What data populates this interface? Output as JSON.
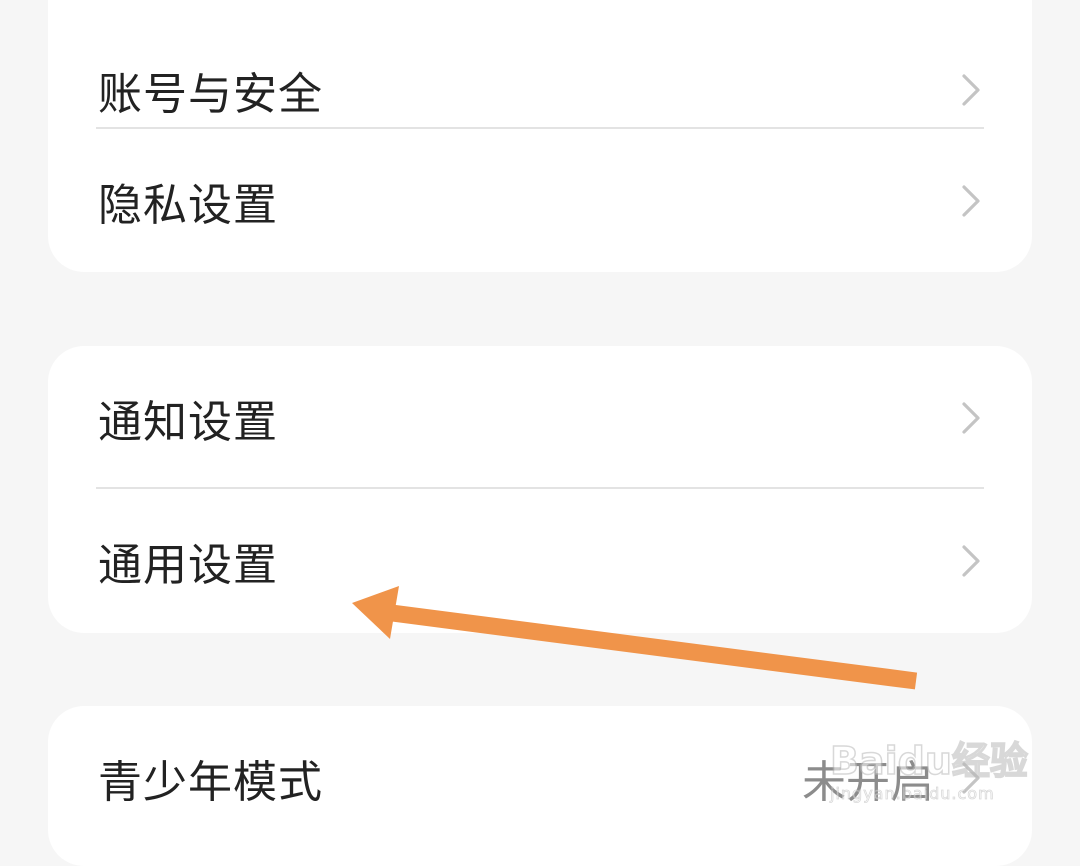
{
  "groups": [
    {
      "items": [
        {
          "label": "账号与安全"
        },
        {
          "label": "隐私设置"
        }
      ]
    },
    {
      "items": [
        {
          "label": "通知设置"
        },
        {
          "label": "通用设置"
        }
      ]
    },
    {
      "items": [
        {
          "label": "青少年模式",
          "value": "未开启"
        }
      ]
    }
  ],
  "annotation": {
    "color": "#f0944a",
    "icon": "arrow-pointer-icon"
  },
  "watermark": {
    "brand": "Baidu经验",
    "sub": "jingyan.baidu.com"
  },
  "colors": {
    "background": "#f6f6f6",
    "card": "#ffffff",
    "text": "#222222",
    "secondary_text": "#8c8c8c",
    "chevron": "#c4c4c4",
    "divider": "#e3e3e3"
  }
}
